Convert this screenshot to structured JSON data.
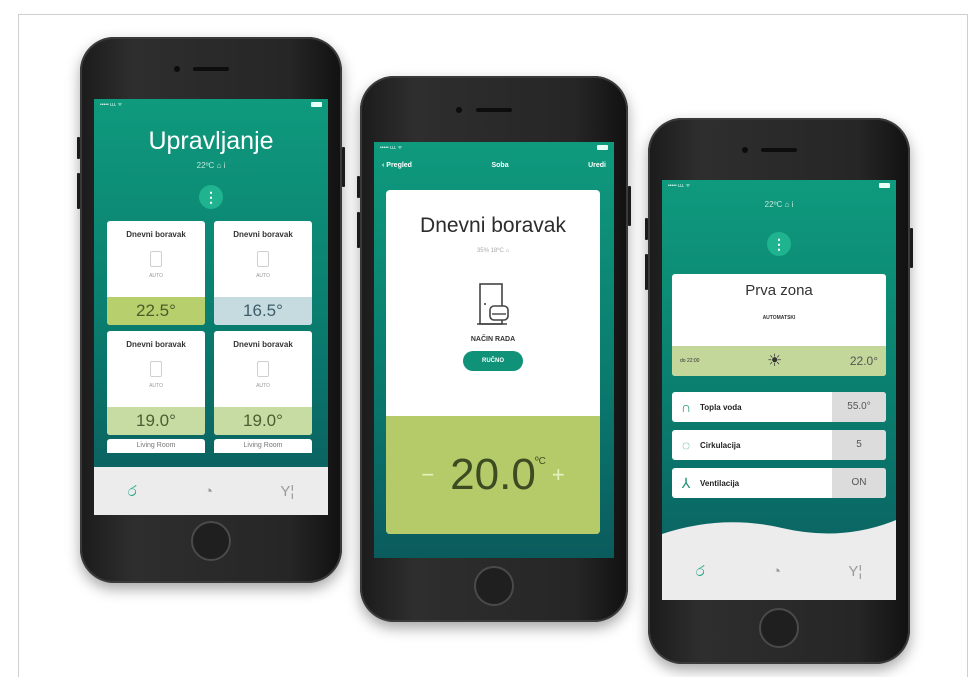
{
  "phone1": {
    "status_left": "••••• ʟʟʟ ᯤ",
    "status_right": "",
    "title": "Upravljanje",
    "subtitle": "22ºC ⌂ i",
    "menu_glyph": "⋮",
    "tiles": [
      {
        "name": "Dnevni boravak",
        "mode": "AUTO",
        "value": "22.5°",
        "style": "green"
      },
      {
        "name": "Dnevni boravak",
        "mode": "AUTO",
        "value": "16.5°",
        "style": "blue"
      },
      {
        "name": "Dnevni boravak",
        "mode": "AUTO",
        "value": "19.0°",
        "style": "pale"
      },
      {
        "name": "Dnevni boravak",
        "mode": "AUTO",
        "value": "19.0°",
        "style": "pale"
      }
    ],
    "peek": [
      "Living Room",
      "Living Room"
    ],
    "tabs": {
      "home_icon": "home-tab-icon",
      "stats_icon": "stats-tab-icon",
      "settings_icon": "settings-tab-icon"
    }
  },
  "phone2": {
    "status_left": "••••• ʟʟʟ ᯤ",
    "back_label": "Pregled",
    "nav_title": "Soba",
    "edit_label": "Uredi",
    "room_name": "Dnevni boravak",
    "meta": "35% 18ºC ⌂",
    "mode_label": "NAČIN RADA",
    "mode_button": "RUČNO",
    "minus": "−",
    "temperature": "20.0",
    "temp_unit": "ºC",
    "plus": "+"
  },
  "phone3": {
    "status_left": "••••• ʟʟʟ ᯤ",
    "subtitle": "22ºC ⌂ i",
    "menu_glyph": "⋮",
    "zone_name": "Prva zona",
    "zone_mode": "AUTOMATSKI",
    "zone_until": "do 22:00",
    "zone_temp": "22.0°",
    "rows": [
      {
        "label": "Topla voda",
        "value": "55.0°",
        "icon": "faucet-icon"
      },
      {
        "label": "Cirkulacija",
        "value": "5",
        "icon": "circulation-icon"
      },
      {
        "label": "Ventilacija",
        "value": "ON",
        "icon": "fan-icon"
      }
    ]
  },
  "colors": {
    "teal": "#0f9a7d",
    "green_bar": "#b7cf6d",
    "blue_bar": "#c5dbe0",
    "pill": "#0f9278"
  }
}
